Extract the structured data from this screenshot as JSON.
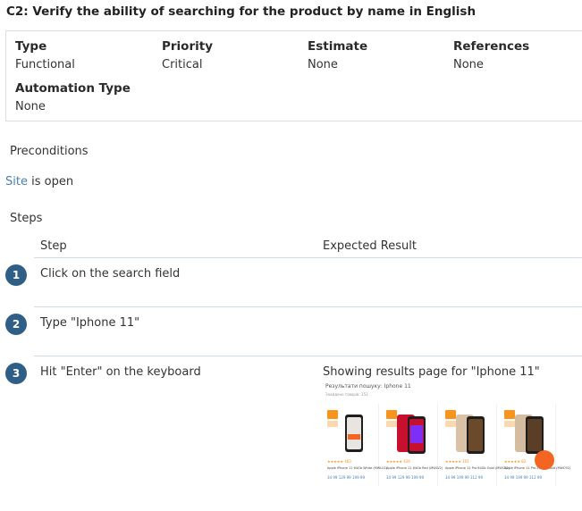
{
  "title": "C2: Verify the ability of searching for the product by name in English",
  "fields": {
    "type": {
      "label": "Type",
      "value": "Functional"
    },
    "priority": {
      "label": "Priority",
      "value": "Critical"
    },
    "estimate": {
      "label": "Estimate",
      "value": "None"
    },
    "references": {
      "label": "References",
      "value": "None"
    },
    "automation": {
      "label": "Automation Type",
      "value": "None"
    }
  },
  "preconditions": {
    "label": "Preconditions",
    "link": "Site",
    "text": " is open"
  },
  "steps": {
    "label": "Steps",
    "col_step": "Step",
    "col_expected": "Expected Result",
    "items": [
      {
        "number": "1",
        "step": "Click on the search field",
        "expected": ""
      },
      {
        "number": "2",
        "step": "Type \"Iphone 11\"",
        "expected": ""
      },
      {
        "number": "3",
        "step": "Hit \"Enter\" on the keyboard",
        "expected": "Showing results page for \"Iphone 11\""
      }
    ]
  },
  "screenshot": {
    "title": "Результати пошуку: Iphone 11",
    "subtitle": "Знайдено товарів: 152",
    "products": [
      {
        "name": "Apple iPhone 11 64Gb White (MWLU2)",
        "price": "34 99  129 99  199 99",
        "stars": "★★★★★  463",
        "color": "#e9e4df"
      },
      {
        "name": "Apple iPhone 11 64Gb Red (MWLV2)",
        "price": "34 99  129 99  199 99",
        "stars": "★★★★★  426",
        "color": "#c8102e"
      },
      {
        "name": "Apple iPhone 11 Pro 64Gb Gold (MWC52)",
        "price": "34 99  199 99  312 99",
        "stars": "★★★★★  101",
        "color": "#d9c2a6"
      },
      {
        "name": "Apple iPhone 11 Pro 256Gb Gold (MWC92)",
        "price": "34 99  199 99  312 99",
        "stars": "★★★★★  82",
        "color": "#d4bca0"
      }
    ]
  },
  "colors": {
    "badge": "#2f5f86",
    "link": "#4a7fb5",
    "divider": "#cfdce8"
  }
}
